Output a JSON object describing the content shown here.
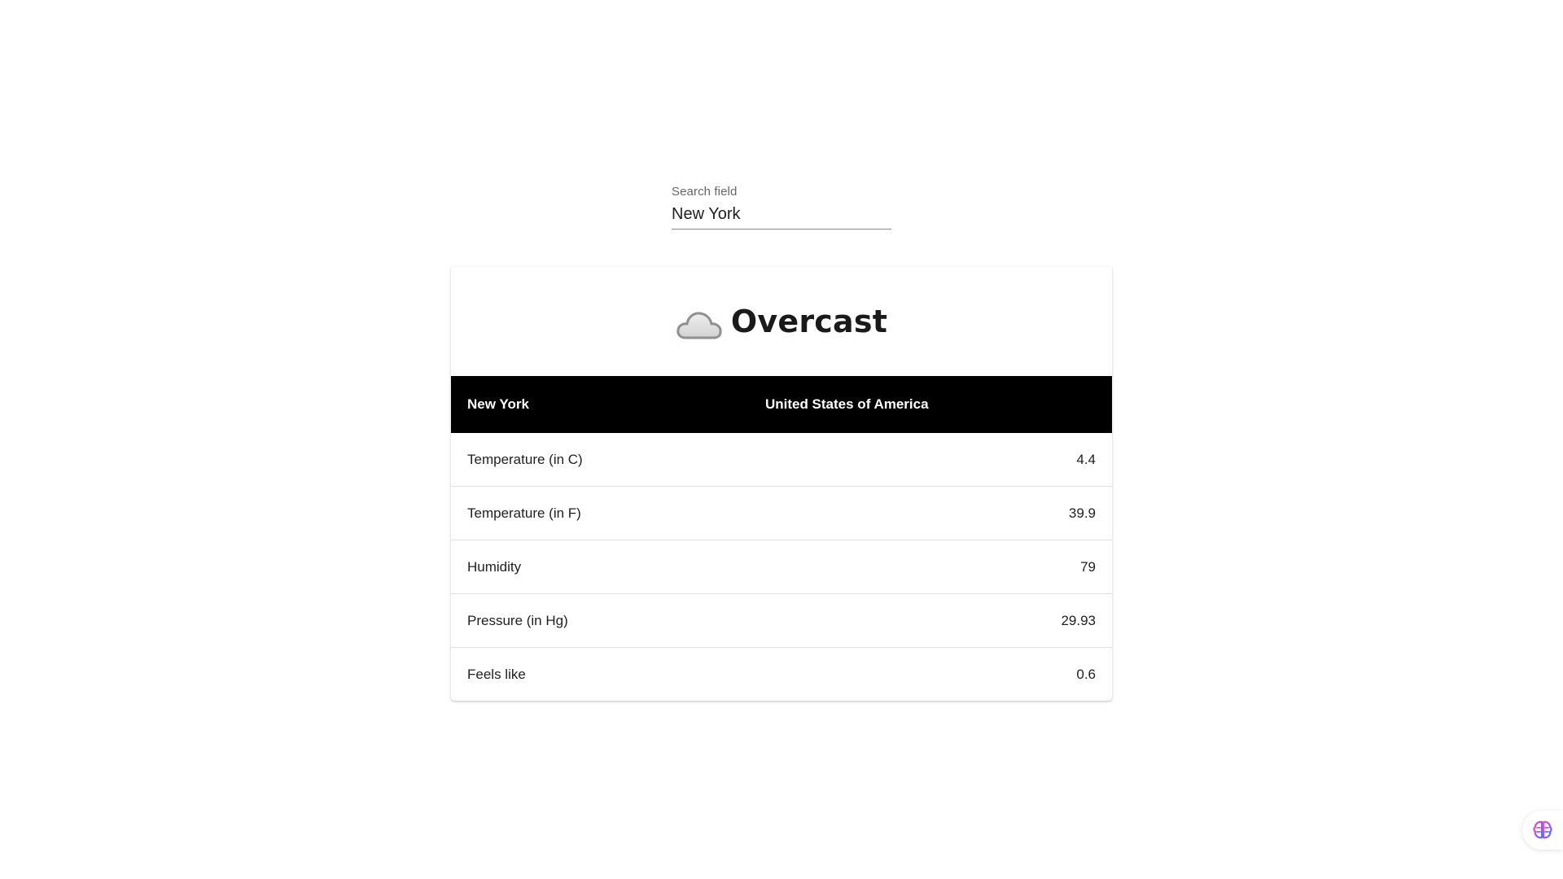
{
  "search": {
    "label": "Search field",
    "value": "New York"
  },
  "weather": {
    "icon": "cloud-icon",
    "condition": "Overcast",
    "city": "New York",
    "country": "United States of America",
    "rows": [
      {
        "label": "Temperature (in C)",
        "value": "4.4"
      },
      {
        "label": "Temperature (in F)",
        "value": "39.9"
      },
      {
        "label": "Humidity",
        "value": "79"
      },
      {
        "label": "Pressure (in Hg)",
        "value": "29.93"
      },
      {
        "label": "Feels like",
        "value": "0.6"
      }
    ]
  },
  "floating_button": {
    "icon": "brain-icon"
  },
  "colors": {
    "header_bg": "#000000",
    "header_text": "#ffffff",
    "row_divider": "#e0e0e0"
  }
}
